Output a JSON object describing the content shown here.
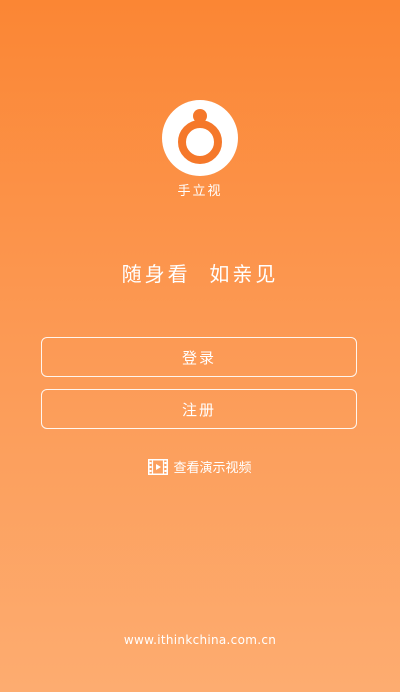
{
  "app": {
    "name": "手立视",
    "logo_icon": "camera-lens-logo-icon"
  },
  "slogan": "随身看  如亲见",
  "actions": {
    "login_label": "登录",
    "register_label": "注册",
    "demo_label": "查看演示视频",
    "demo_icon": "film-strip-icon"
  },
  "footer": {
    "url": "www.ithinkchina.com.cn"
  },
  "colors": {
    "gradient_top": "#fb8634",
    "gradient_bottom": "#fdac70",
    "logo_orange": "#f5782a",
    "text": "#ffffff"
  }
}
